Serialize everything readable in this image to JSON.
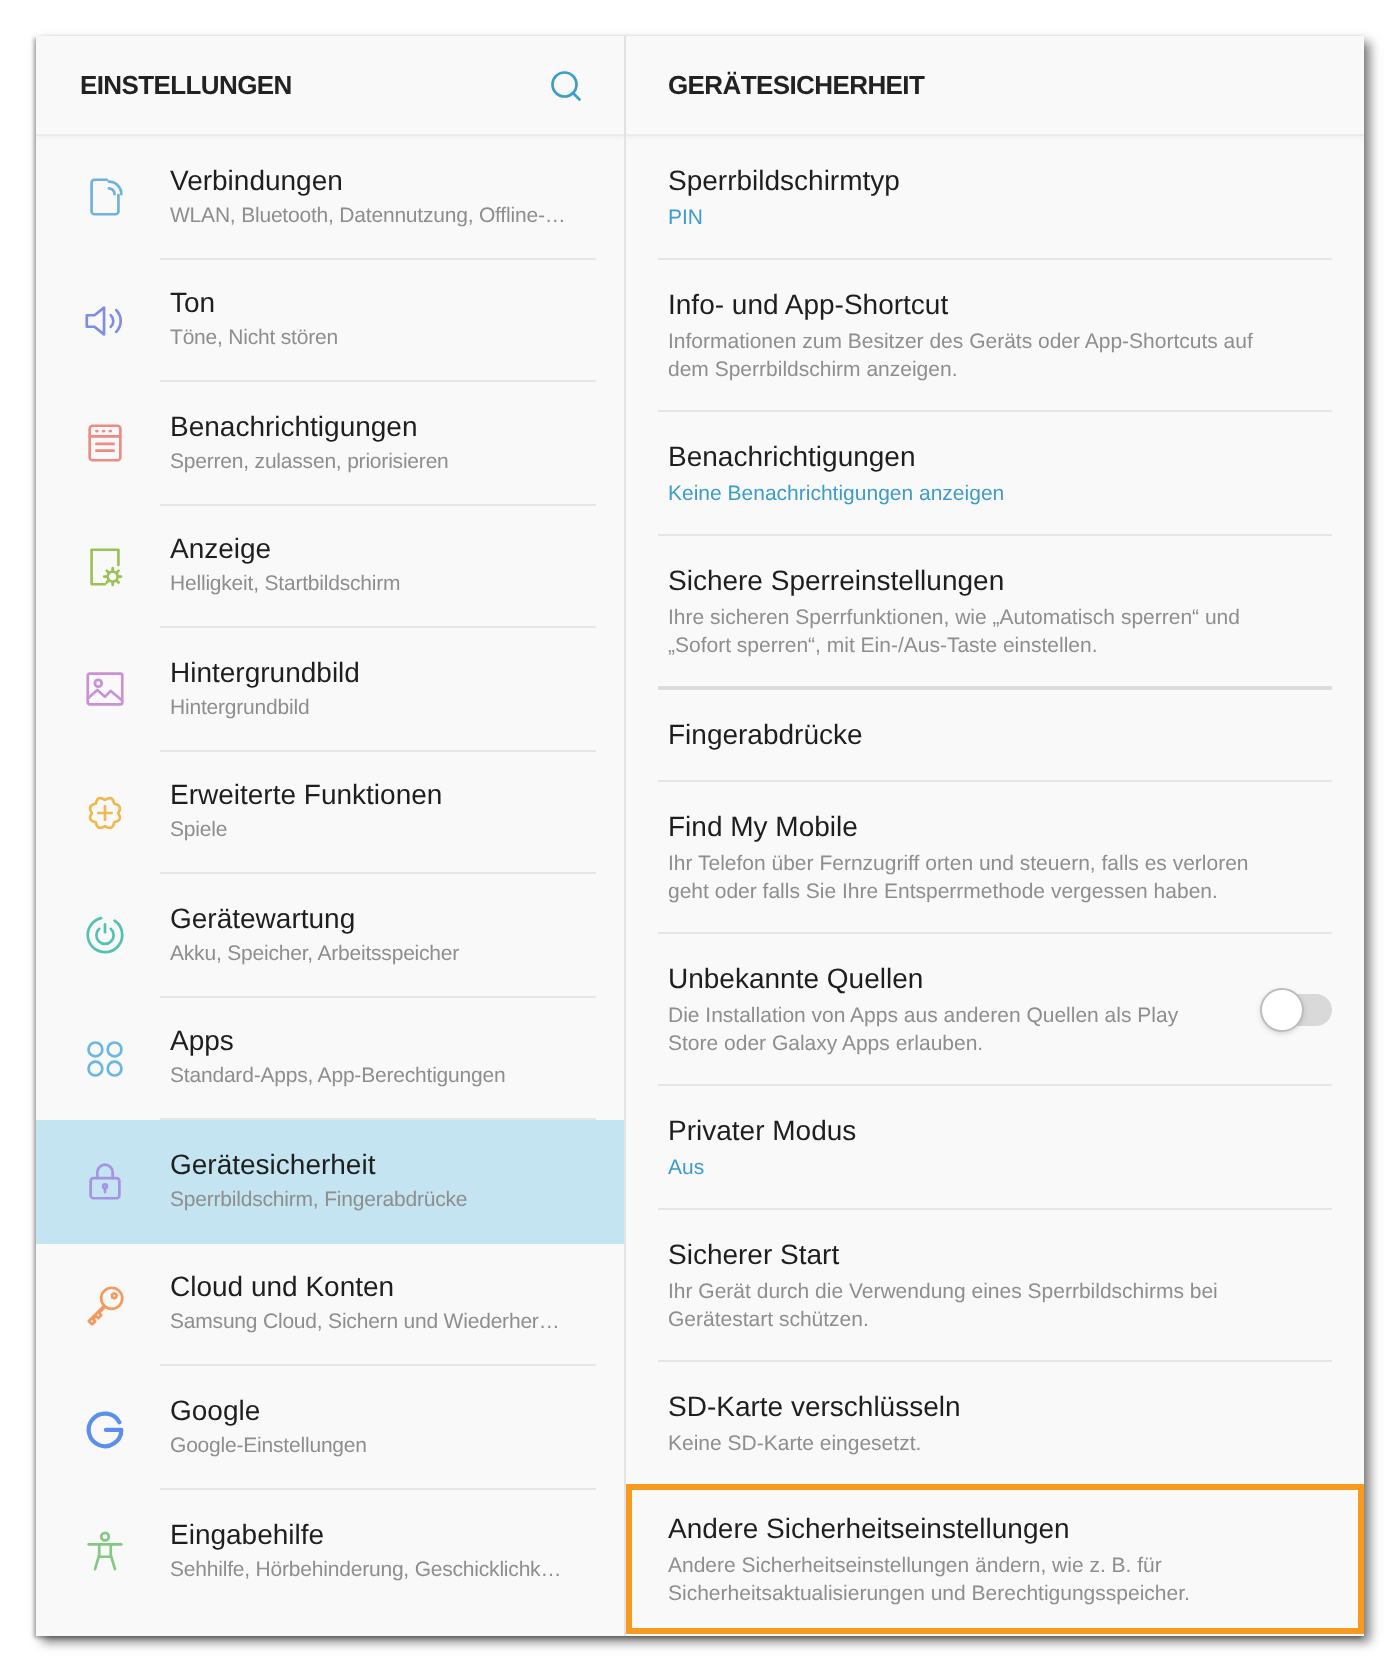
{
  "sidebar": {
    "title": "EINSTELLUNGEN",
    "items": [
      {
        "title": "Verbindungen",
        "subtitle": "WLAN, Bluetooth, Datennutzung, Offline-…",
        "color": "#6fb2df",
        "selected": false
      },
      {
        "title": "Ton",
        "subtitle": "Töne, Nicht stören",
        "color": "#7d8fe3",
        "selected": false
      },
      {
        "title": "Benachrichtigungen",
        "subtitle": "Sperren, zulassen, priorisieren",
        "color": "#ee8c84",
        "selected": false
      },
      {
        "title": "Anzeige",
        "subtitle": "Helligkeit, Startbildschirm",
        "color": "#9cc255",
        "selected": false
      },
      {
        "title": "Hintergrundbild",
        "subtitle": "Hintergrundbild",
        "color": "#c991d6",
        "selected": false
      },
      {
        "title": "Erweiterte Funktionen",
        "subtitle": "Spiele",
        "color": "#f0b851",
        "selected": false
      },
      {
        "title": "Gerätewartung",
        "subtitle": "Akku, Speicher, Arbeitsspeicher",
        "color": "#55c2b1",
        "selected": false
      },
      {
        "title": "Apps",
        "subtitle": "Standard-Apps, App-Berechtigungen",
        "color": "#6cb6e6",
        "selected": false
      },
      {
        "title": "Gerätesicherheit",
        "subtitle": "Sperrbildschirm, Fingerabdrücke",
        "color": "#a593e4",
        "selected": true
      },
      {
        "title": "Cloud und Konten",
        "subtitle": "Samsung Cloud, Sichern und Wiederher…",
        "color": "#f39a5e",
        "selected": false
      },
      {
        "title": "Google",
        "subtitle": "Google-Einstellungen",
        "color": "#5b8fec",
        "selected": false
      },
      {
        "title": "Eingabehilfe",
        "subtitle": "Sehhilfe, Hörbehinderung, Geschicklichk…",
        "color": "#84c883",
        "selected": false
      }
    ]
  },
  "detail": {
    "title": "GERÄTESICHERHEIT",
    "groups": [
      {
        "items": [
          {
            "kind": "link",
            "title": "Sperrbildschirmtyp",
            "value": "PIN",
            "highlighted": false
          },
          {
            "kind": "link",
            "title": "Info- und App-Shortcut",
            "description": "Informationen zum Besitzer des Geräts oder App-Shortcuts auf dem Sperrbildschirm anzeigen.",
            "highlighted": false
          },
          {
            "kind": "link",
            "title": "Benachrichtigungen",
            "value": "Keine Benachrichtigungen anzeigen",
            "highlighted": false
          },
          {
            "kind": "link",
            "title": "Sichere Sperreinstellungen",
            "description": "Ihre sicheren Sperrfunktionen, wie „Automatisch sperren“ und „Sofort sperren“, mit Ein-/Aus-Taste einstellen.",
            "highlighted": false
          }
        ]
      },
      {
        "items": [
          {
            "kind": "link",
            "title": "Fingerabdrücke",
            "highlighted": false
          },
          {
            "kind": "link",
            "title": "Find My Mobile",
            "description": "Ihr Telefon über Fernzugriff orten und steuern, falls es verloren geht oder falls Sie Ihre Entsperrmethode vergessen haben.",
            "highlighted": false
          },
          {
            "kind": "switch",
            "title": "Unbekannte Quellen",
            "description": "Die Installation von Apps aus anderen Quellen als Play Store oder Galaxy Apps erlauben.",
            "on": false,
            "highlighted": false
          },
          {
            "kind": "link",
            "title": "Privater Modus",
            "value": "Aus",
            "highlighted": false
          },
          {
            "kind": "link",
            "title": "Sicherer Start",
            "description": "Ihr Gerät durch die Verwendung eines Sperrbildschirms bei Gerätestart schützen.",
            "highlighted": false
          },
          {
            "kind": "link",
            "title": "SD-Karte verschlüsseln",
            "description": "Keine SD-Karte eingesetzt.",
            "highlighted": false
          },
          {
            "kind": "link",
            "title": "Andere Sicherheitseinstellungen",
            "description": "Andere Sicherheitseinstellungen ändern, wie z. B. für Sicherheitsaktualisierungen und Berechtigungsspeicher.",
            "highlighted": true
          }
        ]
      }
    ]
  }
}
